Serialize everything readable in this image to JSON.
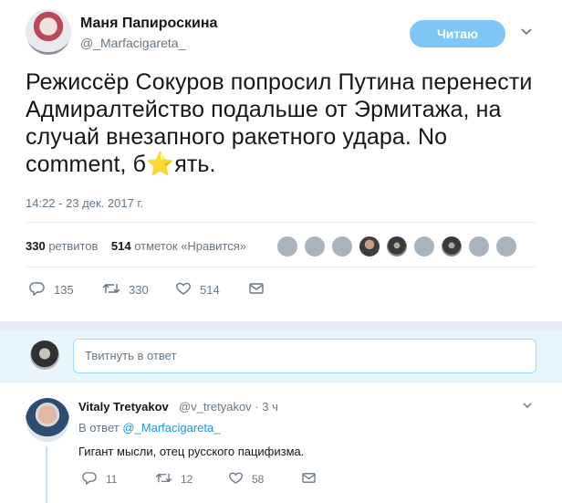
{
  "tweet": {
    "author_name": "Маня Папироскина",
    "author_handle": "@_Marfacigareta_",
    "follow_label": "Читаю",
    "text": "Режиссёр Сокуров попросил Путина перенести Адмиралтейство подальше от Эрмитажа, на случай внезапного ракетного удара. No comment, б⭐ять.",
    "timestamp": "14:22 - 23 дек. 2017 г.",
    "retweets_count": "330",
    "retweets_label": "ретвитов",
    "likes_count": "514",
    "likes_label": "отметок «Нравится»",
    "actions": {
      "replies": "135",
      "retweets": "330",
      "likes": "514"
    }
  },
  "reply_box": {
    "placeholder": "Твитнуть в ответ"
  },
  "reply": {
    "author_name": "Vitaly Tretyakov",
    "author_handle": "@v_tretyakov · 3 ч",
    "replying_prefix": "В ответ",
    "replying_to": "@_Marfacigareta_",
    "text": "Гигант мысли, отец русского пацифизма.",
    "actions": {
      "replies": "11",
      "retweets": "12",
      "likes": "58"
    }
  },
  "icons": [
    "reply-icon",
    "retweet-icon",
    "like-icon",
    "dm-icon",
    "chevron-down-icon"
  ],
  "colors": {
    "follow_button": "#80c6f5",
    "link": "#1b95e0",
    "secondary_text": "#657786",
    "reply_bar_bg": "#e8f5fd"
  }
}
